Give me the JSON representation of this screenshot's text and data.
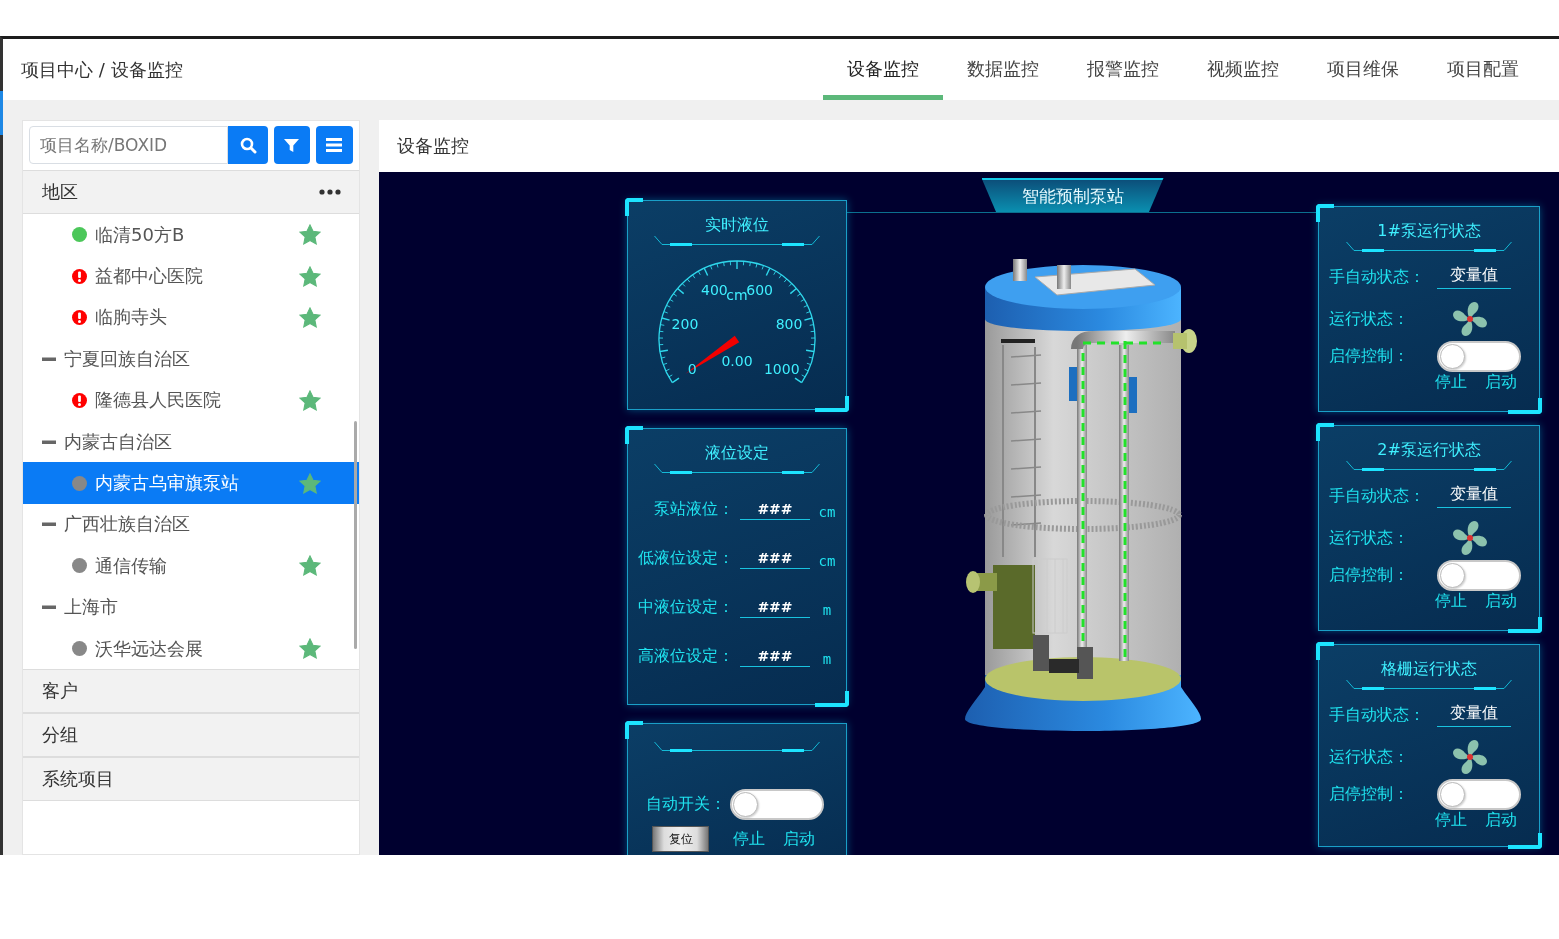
{
  "breadcrumb": "项目中心 / 设备监控",
  "tabs": [
    {
      "label": "设备监控",
      "selected": true
    },
    {
      "label": "数据监控",
      "selected": false
    },
    {
      "label": "报警监控",
      "selected": false
    },
    {
      "label": "视频监控",
      "selected": false
    },
    {
      "label": "项目维保",
      "selected": false
    },
    {
      "label": "项目配置",
      "selected": false
    }
  ],
  "sidebar": {
    "search": {
      "placeholder": "项目名称/BOXID"
    },
    "sections": [
      {
        "title": "地区",
        "expanded": true,
        "tree": [
          {
            "label": "临清50方B",
            "kind": "dot",
            "color": "#4cc75a",
            "starred": true,
            "selected": false
          },
          {
            "label": "益都中心医院",
            "kind": "alert",
            "starred": true,
            "selected": false
          },
          {
            "label": "临朐寺头",
            "kind": "alert",
            "starred": true,
            "selected": false
          },
          {
            "label": "宁夏回族自治区",
            "expanded": true,
            "children": [
              {
                "label": "隆德县人民医院",
                "kind": "alert",
                "starred": true,
                "selected": false
              }
            ]
          },
          {
            "label": "内蒙古自治区",
            "expanded": true,
            "children": [
              {
                "label": "内蒙古乌审旗泵站",
                "kind": "dot",
                "color": "#888888",
                "starred": true,
                "selected": true
              }
            ]
          },
          {
            "label": "广西壮族自治区",
            "expanded": true,
            "children": [
              {
                "label": "通信传输",
                "kind": "dot",
                "color": "#888888",
                "starred": true,
                "selected": false
              }
            ]
          },
          {
            "label": "上海市",
            "expanded": true,
            "children": [
              {
                "label": "沃华远达会展",
                "kind": "dot",
                "color": "#888888",
                "starred": true,
                "selected": false
              }
            ]
          }
        ]
      },
      {
        "title": "客户",
        "expanded": false
      },
      {
        "title": "分组",
        "expanded": false
      },
      {
        "title": "系统项目",
        "expanded": false
      }
    ]
  },
  "panel": {
    "title": "设备监控",
    "station_title": "智能预制泵站",
    "gauge": {
      "title": "实时液位",
      "unit": "cm",
      "ticks": [
        "0",
        "200",
        "400",
        "600",
        "800",
        "1000"
      ],
      "reading": "0.00"
    },
    "level_settings": {
      "title": "液位设定",
      "rows": [
        {
          "label": "泵站液位：",
          "value": "###",
          "unit": "cm"
        },
        {
          "label": "低液位设定：",
          "value": "###",
          "unit": "cm"
        },
        {
          "label": "中液位设定：",
          "value": "###",
          "unit": "m"
        },
        {
          "label": "高液位设定：",
          "value": "###",
          "unit": "m"
        }
      ]
    },
    "auto_switch": {
      "label": "自动开关：",
      "on": false,
      "reset": "复位",
      "off_label": "停止",
      "on_label": "启动"
    },
    "status_cards": [
      {
        "title": "1#泵运行状态",
        "mode_label": "手自动状态：",
        "mode_value": "变量值",
        "run_label": "运行状态：",
        "control_label": "启停控制：",
        "on": false,
        "off_label": "停止",
        "on_label": "启动"
      },
      {
        "title": "2#泵运行状态",
        "mode_label": "手自动状态：",
        "mode_value": "变量值",
        "run_label": "运行状态：",
        "control_label": "启停控制：",
        "on": false,
        "off_label": "停止",
        "on_label": "启动"
      },
      {
        "title": "格栅运行状态",
        "mode_label": "手自动状态：",
        "mode_value": "变量值",
        "run_label": "运行状态：",
        "control_label": "启停控制：",
        "on": false,
        "off_label": "停止",
        "on_label": "启动"
      }
    ]
  }
}
